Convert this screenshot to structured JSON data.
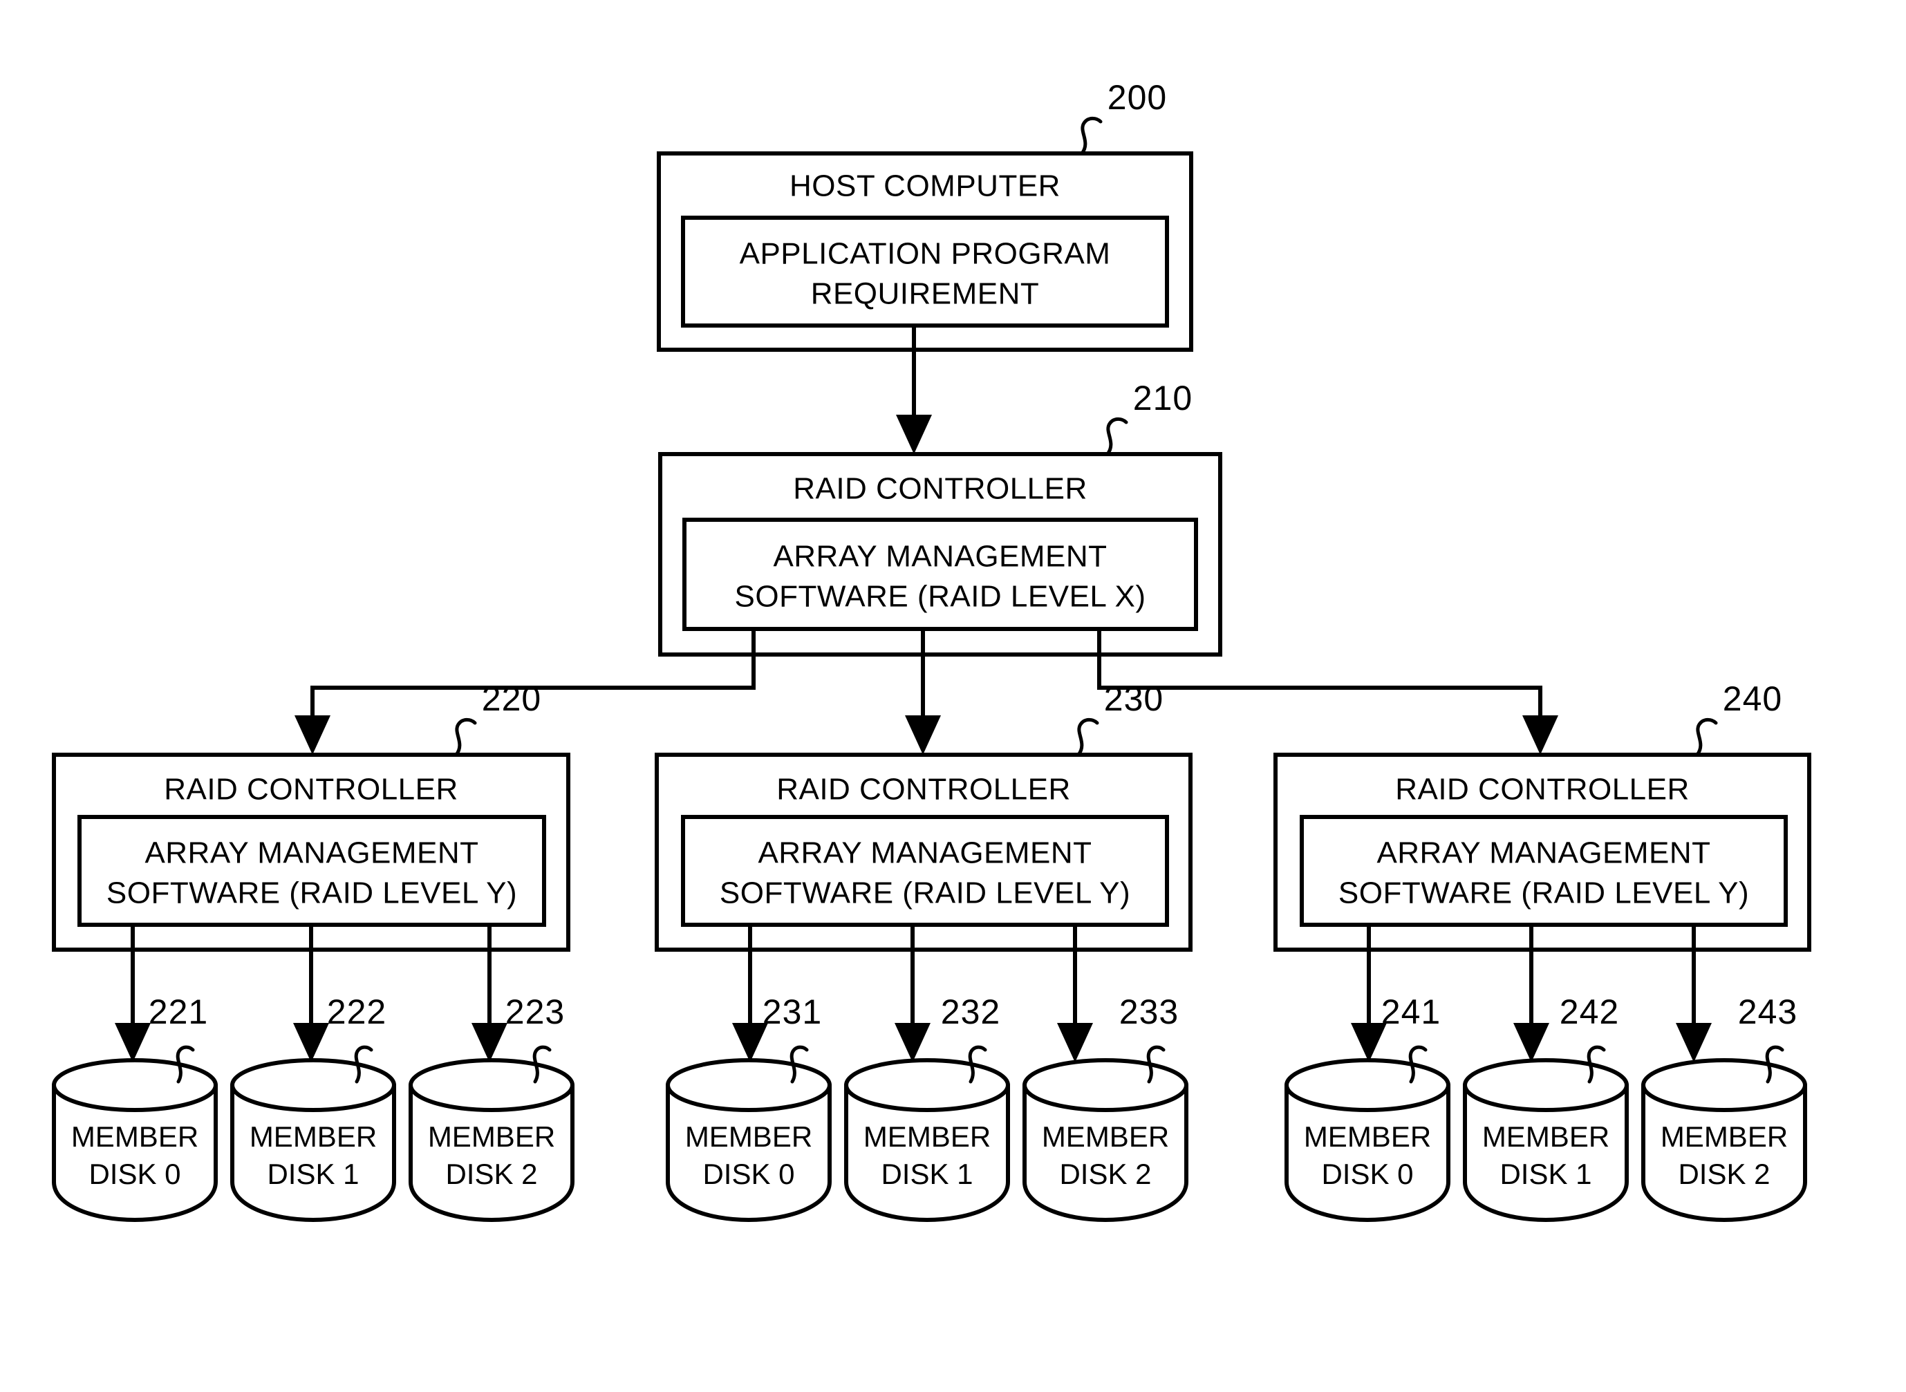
{
  "figure": {
    "title": "RAID hierarchical architecture block diagram",
    "stroke_color": "#000000",
    "background_color": "#ffffff"
  },
  "host": {
    "ref": "200",
    "title": "HOST COMPUTER",
    "inner_line1": "APPLICATION PROGRAM",
    "inner_line2": "REQUIREMENT"
  },
  "master_controller": {
    "ref": "210",
    "title": "RAID CONTROLLER",
    "inner_line1": "ARRAY MANAGEMENT",
    "inner_line2": "SOFTWARE (RAID LEVEL X)"
  },
  "controllers": [
    {
      "ref": "220",
      "title": "RAID CONTROLLER",
      "inner_line1": "ARRAY MANAGEMENT",
      "inner_line2": "SOFTWARE (RAID LEVEL Y)",
      "disks": [
        {
          "ref": "221",
          "line1": "MEMBER",
          "line2": "DISK 0"
        },
        {
          "ref": "222",
          "line1": "MEMBER",
          "line2": "DISK 1"
        },
        {
          "ref": "223",
          "line1": "MEMBER",
          "line2": "DISK 2"
        }
      ]
    },
    {
      "ref": "230",
      "title": "RAID CONTROLLER",
      "inner_line1": "ARRAY MANAGEMENT",
      "inner_line2": "SOFTWARE (RAID LEVEL Y)",
      "disks": [
        {
          "ref": "231",
          "line1": "MEMBER",
          "line2": "DISK 0"
        },
        {
          "ref": "232",
          "line1": "MEMBER",
          "line2": "DISK 1"
        },
        {
          "ref": "233",
          "line1": "MEMBER",
          "line2": "DISK 2"
        }
      ]
    },
    {
      "ref": "240",
      "title": "RAID CONTROLLER",
      "inner_line1": "ARRAY MANAGEMENT",
      "inner_line2": "SOFTWARE (RAID LEVEL Y)",
      "disks": [
        {
          "ref": "241",
          "line1": "MEMBER",
          "line2": "DISK 0"
        },
        {
          "ref": "242",
          "line1": "MEMBER",
          "line2": "DISK 1"
        },
        {
          "ref": "243",
          "line1": "MEMBER",
          "line2": "DISK 2"
        }
      ]
    }
  ]
}
